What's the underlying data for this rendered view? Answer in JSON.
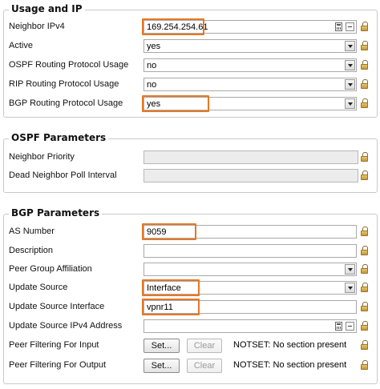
{
  "sections": {
    "usage": {
      "title": "Usage and IP"
    },
    "ospf": {
      "title": "OSPF Parameters"
    },
    "bgp": {
      "title": "BGP Parameters"
    }
  },
  "usage": {
    "neighbor_ipv4": {
      "label": "Neighbor IPv4",
      "value": "169.254.254.61"
    },
    "active": {
      "label": "Active",
      "value": "yes"
    },
    "ospf_usage": {
      "label": "OSPF Routing Protocol Usage",
      "value": "no"
    },
    "rip_usage": {
      "label": "RIP Routing Protocol Usage",
      "value": "no"
    },
    "bgp_usage": {
      "label": "BGP Routing Protocol Usage",
      "value": "yes"
    }
  },
  "ospf": {
    "neighbor_priority": {
      "label": "Neighbor Priority",
      "value": ""
    },
    "dead_interval": {
      "label": "Dead Neighbor Poll Interval",
      "value": ""
    }
  },
  "bgp": {
    "as_number": {
      "label": "AS Number",
      "value": "9059"
    },
    "description": {
      "label": "Description",
      "value": ""
    },
    "peer_group": {
      "label": "Peer Group Affiliation",
      "value": ""
    },
    "update_source": {
      "label": "Update Source",
      "value": "Interface"
    },
    "update_source_interface": {
      "label": "Update Source Interface",
      "value": "vpnr11"
    },
    "update_source_ipv4": {
      "label": "Update Source IPv4 Address",
      "value": ""
    },
    "filter_input": {
      "label": "Peer Filtering For Input",
      "set_label": "Set...",
      "clear_label": "Clear",
      "status": "NOTSET: No section present"
    },
    "filter_output": {
      "label": "Peer Filtering For Output",
      "set_label": "Set...",
      "clear_label": "Clear",
      "status": "NOTSET: No section present"
    }
  },
  "colors": {
    "highlight": "#e87722",
    "lock": "#c49a3a"
  },
  "icons": [
    "calculator-icon",
    "remove-icon",
    "lock-icon",
    "dropdown-arrow-icon"
  ]
}
